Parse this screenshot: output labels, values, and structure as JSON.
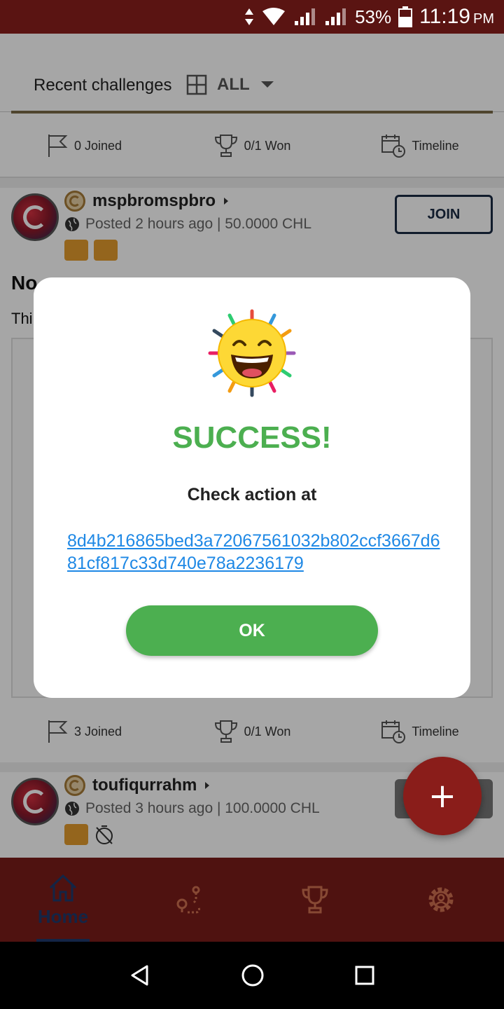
{
  "status_bar": {
    "battery": "53%",
    "time": "11:19",
    "ampm": "PM"
  },
  "header": {
    "title": "Recent challenges",
    "filter_label": "ALL"
  },
  "top_stats": {
    "joined": "0 Joined",
    "won": "0/1 Won",
    "timeline": "Timeline"
  },
  "card1": {
    "username": "mspbromspbro",
    "meta": "Posted 2 hours ago | 50.0000 CHL",
    "join_label": "JOIN",
    "title": "No",
    "desc": "Thi",
    "stats": {
      "joined": "3 Joined",
      "won": "0/1 Won",
      "timeline": "Timeline"
    }
  },
  "card2": {
    "username": "toufiqurrahm",
    "meta": "Posted 3 hours ago | 100.0000 CHL"
  },
  "bottom_nav": {
    "home": "Home"
  },
  "fab": {
    "symbol": "+"
  },
  "dialog": {
    "title": "SUCCESS!",
    "message": "Check action at",
    "link": "8d4b216865bed3a72067561032b802ccf3667d681cf817c33d740e78a2236179",
    "ok_label": "OK"
  },
  "colors": {
    "status_bar": "#5a1412",
    "bottom_nav": "#7a1c1a",
    "success": "#4caf50",
    "link": "#1e88e5",
    "fab": "#8a1d1a"
  }
}
